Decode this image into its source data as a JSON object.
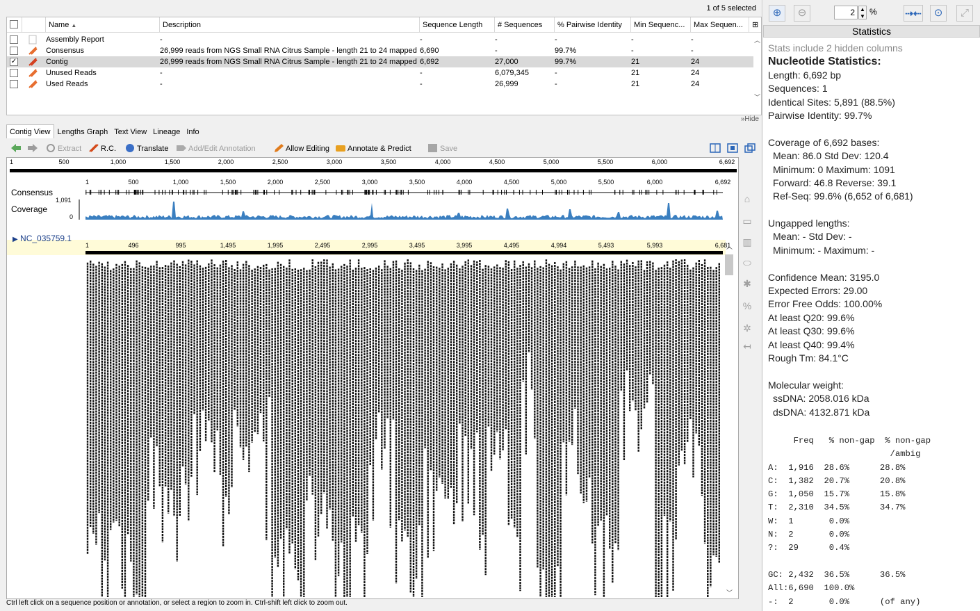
{
  "selection_text": "1 of 5 selected",
  "table": {
    "columns": [
      "Name",
      "Description",
      "Sequence Length",
      "# Sequences",
      "% Pairwise Identity",
      "Min Sequenc...",
      "Max Sequen..."
    ],
    "rows": [
      {
        "name": "Assembly Report",
        "description": "-",
        "seq_length": "-",
        "num_seqs": "-",
        "pairwise": "-",
        "min": "-",
        "max": "-",
        "checked": false,
        "selected": false,
        "icon": "report-icon"
      },
      {
        "name": "Consensus",
        "description": "26,999 reads from NGS Small RNA Citrus Sample - length 21 to 24 mapped...",
        "seq_length": "6,690",
        "num_seqs": "-",
        "pairwise": "99.7%",
        "min": "-",
        "max": "-",
        "checked": false,
        "selected": false,
        "icon": "sequence-icon"
      },
      {
        "name": "Contig",
        "description": "26,999 reads from NGS Small RNA Citrus Sample - length 21 to 24 mapped...",
        "seq_length": "6,692",
        "num_seqs": "27,000",
        "pairwise": "99.7%",
        "min": "21",
        "max": "24",
        "checked": true,
        "selected": true,
        "icon": "contig-icon"
      },
      {
        "name": "Unused Reads",
        "description": "-",
        "seq_length": "-",
        "num_seqs": "6,079,345",
        "pairwise": "-",
        "min": "21",
        "max": "24",
        "checked": false,
        "selected": false,
        "icon": "sequence-list-icon"
      },
      {
        "name": "Used Reads",
        "description": "-",
        "seq_length": "-",
        "num_seqs": "26,999",
        "pairwise": "-",
        "min": "21",
        "max": "24",
        "checked": false,
        "selected": false,
        "icon": "sequence-list-icon"
      }
    ]
  },
  "hide_label": "Hide",
  "tabs": [
    "Contig View",
    "Lengths Graph",
    "Text View",
    "Lineage",
    "Info"
  ],
  "toolbar": {
    "extract": "Extract",
    "rc": "R.C.",
    "translate": "Translate",
    "annotation": "Add/Edit Annotation",
    "editing": "Allow Editing",
    "annotate": "Annotate & Predict",
    "save": "Save"
  },
  "ruler_top": [
    "1",
    "500",
    "1,000",
    "1,500",
    "2,000",
    "2,500",
    "3,000",
    "3,500",
    "4,000",
    "4,500",
    "5,000",
    "5,500",
    "6,000",
    "6,692"
  ],
  "ruler_consensus": [
    "1",
    "500",
    "1,000",
    "1,500",
    "2,000",
    "2,500",
    "3,000",
    "3,500",
    "4,000",
    "4,500",
    "5,000",
    "5,500",
    "6,000",
    "6,692"
  ],
  "ruler_reference": [
    "1",
    "496",
    "995",
    "1,495",
    "1,995",
    "2,495",
    "2,995",
    "3,495",
    "3,995",
    "4,495",
    "4,994",
    "5,493",
    "5,993",
    "6,681"
  ],
  "track_labels": {
    "consensus": "Consensus",
    "coverage": "Coverage",
    "cov_max": "1,091",
    "cov_min": "0"
  },
  "reference_name": "NC_035759.1",
  "status_text": "Ctrl left click on a sequence position or annotation, or select a region to zoom in. Ctrl-shift left click to zoom out.",
  "zoom": {
    "value": "2",
    "unit": "%"
  },
  "stats_title": "Statistics",
  "stats_lines": [
    {
      "t": "Stats include 2 hidden columns",
      "c": "hint"
    },
    {
      "t": "Nucleotide Statistics:",
      "c": "h"
    },
    {
      "t": "Length: 6,692 bp",
      "c": ""
    },
    {
      "t": "Sequences: 1",
      "c": ""
    },
    {
      "t": "Identical Sites: 5,891 (88.5%)",
      "c": ""
    },
    {
      "t": "Pairwise Identity: 99.7%",
      "c": ""
    },
    {
      "t": "",
      "c": ""
    },
    {
      "t": "Coverage of 6,692 bases:",
      "c": ""
    },
    {
      "t": "Mean: 86.0     Std Dev: 120.4",
      "c": "ind"
    },
    {
      "t": "Minimum: 0    Maximum: 1091",
      "c": "ind"
    },
    {
      "t": "Forward: 46.8   Reverse: 39.1",
      "c": "ind"
    },
    {
      "t": "Ref-Seq: 99.6% (6,652 of 6,681)",
      "c": "ind"
    },
    {
      "t": "",
      "c": ""
    },
    {
      "t": "Ungapped lengths:",
      "c": ""
    },
    {
      "t": "Mean: -       Std Dev: -",
      "c": "ind"
    },
    {
      "t": "Minimum: -    Maximum: -",
      "c": "ind"
    },
    {
      "t": "",
      "c": ""
    },
    {
      "t": "Confidence Mean: 3195.0",
      "c": ""
    },
    {
      "t": "Expected Errors: 29.00",
      "c": ""
    },
    {
      "t": "Error Free Odds: 100.00%",
      "c": ""
    },
    {
      "t": "At least Q20: 99.6%",
      "c": ""
    },
    {
      "t": "At least Q30: 99.6%",
      "c": ""
    },
    {
      "t": "At least Q40: 99.4%",
      "c": ""
    },
    {
      "t": "Rough Tm: 84.1°C",
      "c": ""
    },
    {
      "t": "",
      "c": ""
    },
    {
      "t": "Molecular weight:",
      "c": ""
    },
    {
      "t": "ssDNA: 2058.016 kDa",
      "c": "ind"
    },
    {
      "t": "dsDNA: 4132.871 kDa",
      "c": "ind"
    }
  ],
  "freq_lines": [
    "     Freq   % non-gap  % non-gap",
    "                        /ambig",
    "A:  1,916  28.6%      28.8%",
    "C:  1,382  20.7%      20.8%",
    "G:  1,050  15.7%      15.8%",
    "T:  2,310  34.5%      34.7%",
    "W:  1       0.0%",
    "N:  2       0.0%",
    "?:  29      0.4%",
    "",
    "GC: 2,432  36.5%      36.5%",
    "All:6,690  100.0%",
    "-:  2       0.0%      (of any)"
  ],
  "colors": {
    "coverage_fill": "#3a7fc0",
    "selected_row": "#d9d9d9",
    "reference_band": "#fffbd8",
    "accent": "#2b66b8"
  }
}
